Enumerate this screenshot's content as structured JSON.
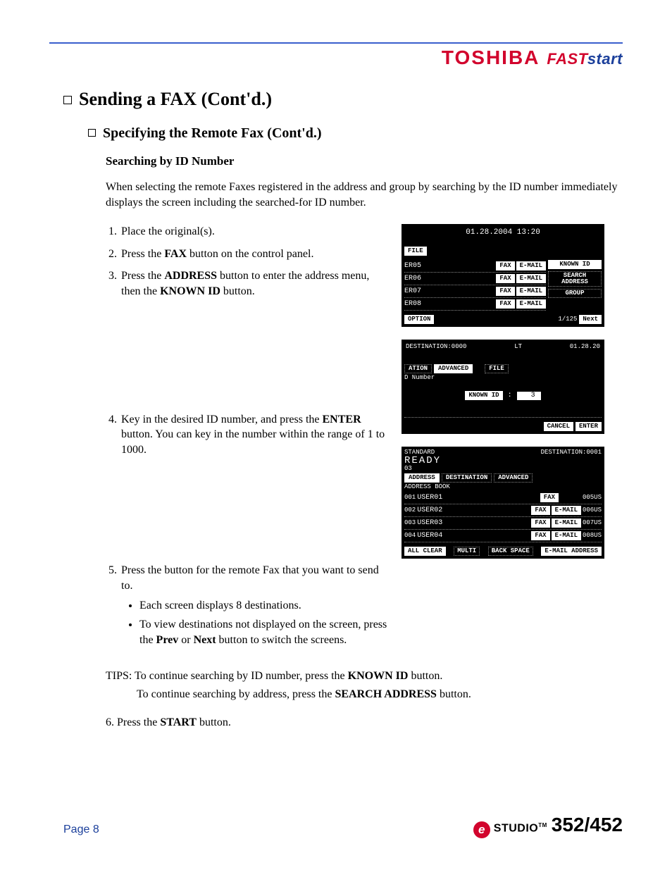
{
  "brand": {
    "toshiba": "TOSHIBA",
    "fast": "FAST",
    "start": "start"
  },
  "headings": {
    "h1": "Sending a FAX (Cont'd.)",
    "h2": "Specifying the Remote Fax (Cont'd.)",
    "h3": "Searching by ID Number"
  },
  "intro": "When selecting the remote Faxes registered in the address and group by searching by the ID number immediately displays the screen including the searched-for ID number.",
  "steps": {
    "s1": "Place the original(s).",
    "s2a": "Press the ",
    "s2b": "FAX",
    "s2c": " button on the control panel.",
    "s3a": "Press the ",
    "s3b": "ADDRESS",
    "s3c": " button to enter the address menu, then the ",
    "s3d": "KNOWN ID",
    "s3e": " button.",
    "s4a": "Key in the desired ID number, and press the ",
    "s4b": "ENTER",
    "s4c": " button. You can key in the number within the range of 1 to 1000.",
    "s5": "Press the button for the remote Fax that you want to send to.",
    "s5_b1": "Each screen displays 8 destinations.",
    "s5_b2a": "To view destinations not displayed on the screen, press the ",
    "s5_b2b": "Prev",
    "s5_b2c": " or ",
    "s5_b2d": "Next",
    "s5_b2e": " button to switch the screens.",
    "s6a": "Press the ",
    "s6b": "START",
    "s6c": " button."
  },
  "tips": {
    "line1a": "TIPS: To continue searching by ID number, press the ",
    "line1b": "KNOWN ID",
    "line1c": " button.",
    "line2a": "To continue searching by address, press the ",
    "line2b": "SEARCH ADDRESS",
    "line2c": " button."
  },
  "footer": {
    "page": "Page 8",
    "studio": "STUDIO",
    "tm": "TM",
    "model": "352/452",
    "e": "e"
  },
  "lcd1": {
    "timestamp": "01.28.2004 13:20",
    "file": "FILE",
    "entries": [
      "ER05",
      "ER06",
      "ER07",
      "ER08"
    ],
    "fax": "FAX",
    "email": "E-MAIL",
    "known_id": "KNOWN ID",
    "search_addr": "SEARCH ADDRESS",
    "group": "GROUP",
    "option": "OPTION",
    "pager": "1/125",
    "next": "Next"
  },
  "lcd2": {
    "dest": "DESTINATION:0000",
    "lt": "LT",
    "date": "01.28.20",
    "ation": "ATION",
    "advanced": "ADVANCED",
    "file": "FILE",
    "dnumber": "D Number",
    "known_id": "KNOWN ID",
    "colon": ":",
    "value": "3",
    "cancel": "CANCEL",
    "enter": "ENTER"
  },
  "lcd3": {
    "standard": "STANDARD",
    "dest": "DESTINATION:0001",
    "ready": "READY",
    "z": "03",
    "tabs": {
      "address": "ADDRESS",
      "destination": "DESTINATION",
      "advanced": "ADVANCED"
    },
    "book": "ADDRESS BOOK",
    "rows": [
      {
        "id": "001",
        "name": "USER01",
        "right": "005US"
      },
      {
        "id": "002",
        "name": "USER02",
        "right": "006US"
      },
      {
        "id": "003",
        "name": "USER03",
        "right": "007US"
      },
      {
        "id": "004",
        "name": "USER04",
        "right": "008US"
      }
    ],
    "fax": "FAX",
    "email": "E-MAIL",
    "allclear": "ALL CLEAR",
    "multi": "MULTI",
    "backspace": "BACK SPACE",
    "emailaddr": "E-MAIL ADDRESS"
  }
}
